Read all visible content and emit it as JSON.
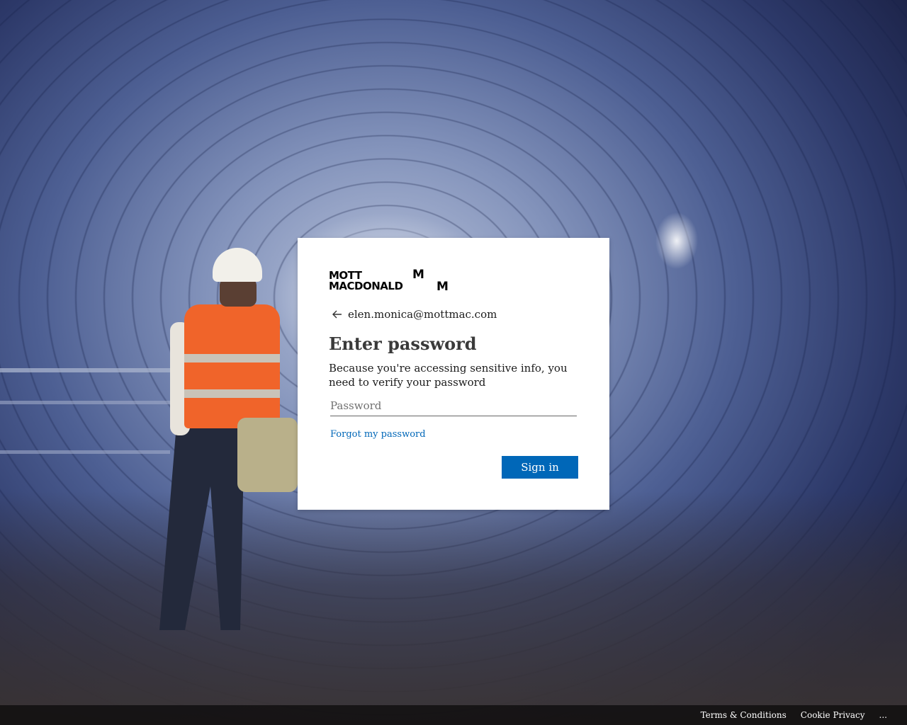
{
  "brand": {
    "logo_text": "MOTT MACDONALD",
    "logo_mark": "M M"
  },
  "identity": {
    "back_icon": "arrow-left-icon",
    "email": "elen.monica@mottmac.com"
  },
  "form": {
    "title": "Enter password",
    "description": "Because you're accessing sensitive info, you need to verify your password",
    "password_placeholder": "Password",
    "password_value": "",
    "forgot_link": "Forgot my password",
    "submit_label": "Sign in"
  },
  "footer": {
    "terms": "Terms & Conditions",
    "cookie": "Cookie Privacy",
    "more": "..."
  },
  "colors": {
    "accent": "#0067b8",
    "dialog_bg": "#ffffff",
    "footer_bg": "rgba(0,0,0,0.6)"
  }
}
